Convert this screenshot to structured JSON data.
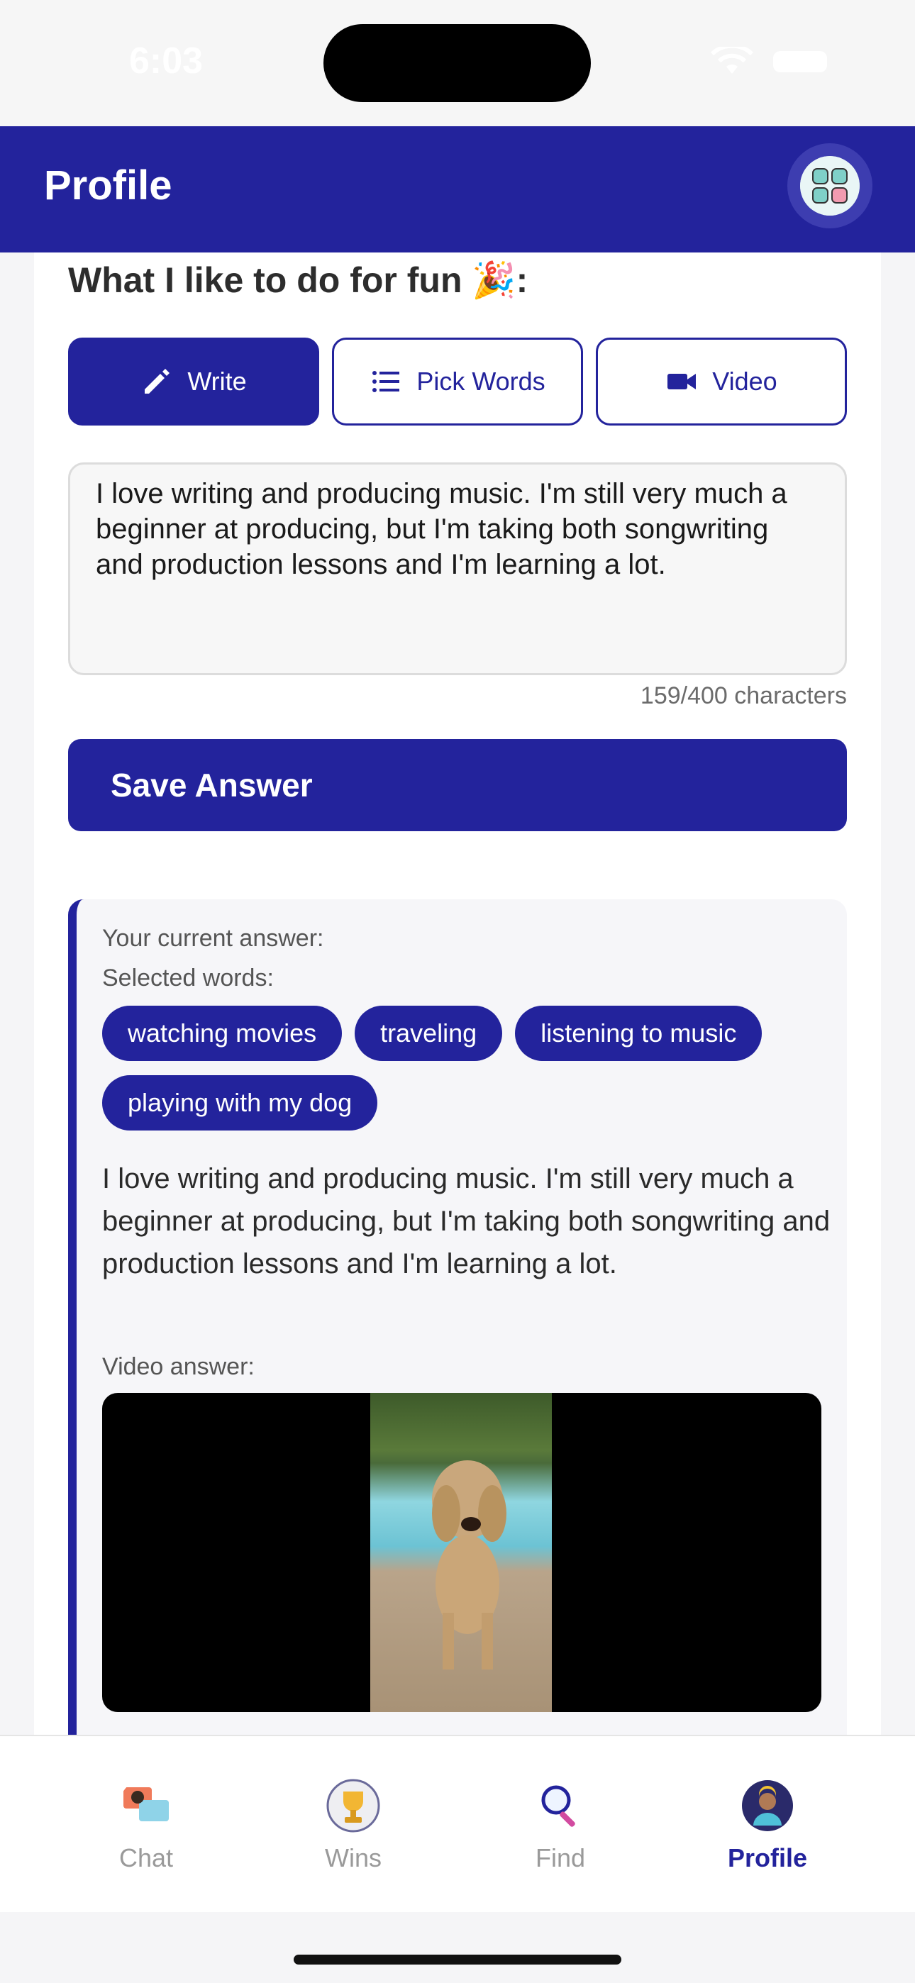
{
  "status": {
    "time": "6:03"
  },
  "header": {
    "title": "Profile"
  },
  "question": {
    "label": "What I like to do for fun",
    "emoji": "🎉",
    "suffix": ":"
  },
  "modes": [
    {
      "label": "Write",
      "icon": "pencil-icon",
      "active": true
    },
    {
      "label": "Pick Words",
      "icon": "list-icon",
      "active": false
    },
    {
      "label": "Video",
      "icon": "video-camera-icon",
      "active": false
    }
  ],
  "editor": {
    "value": "I love writing and producing music. I'm still very much a beginner at producing, but I'm taking both songwriting and production lessons and I'm learning a lot.",
    "char_count": "159/400 characters"
  },
  "save_button": "Save Answer",
  "current": {
    "label": "Your current answer:",
    "selected_label": "Selected words:",
    "chips": [
      "watching movies",
      "traveling",
      "listening to music",
      "playing with my dog"
    ],
    "text": "I love writing and producing music. I'm still very much a beginner at producing, but I'm taking both songwriting and production lessons and I'm learning a lot.",
    "video_label": "Video answer:"
  },
  "tabs": [
    {
      "label": "Chat",
      "icon": "chat-icon"
    },
    {
      "label": "Wins",
      "icon": "trophy-icon"
    },
    {
      "label": "Find",
      "icon": "magnifier-icon"
    },
    {
      "label": "Profile",
      "icon": "avatar-icon",
      "active": true
    }
  ],
  "colors": {
    "primary": "#23239c",
    "muted": "#9a9a9a"
  }
}
